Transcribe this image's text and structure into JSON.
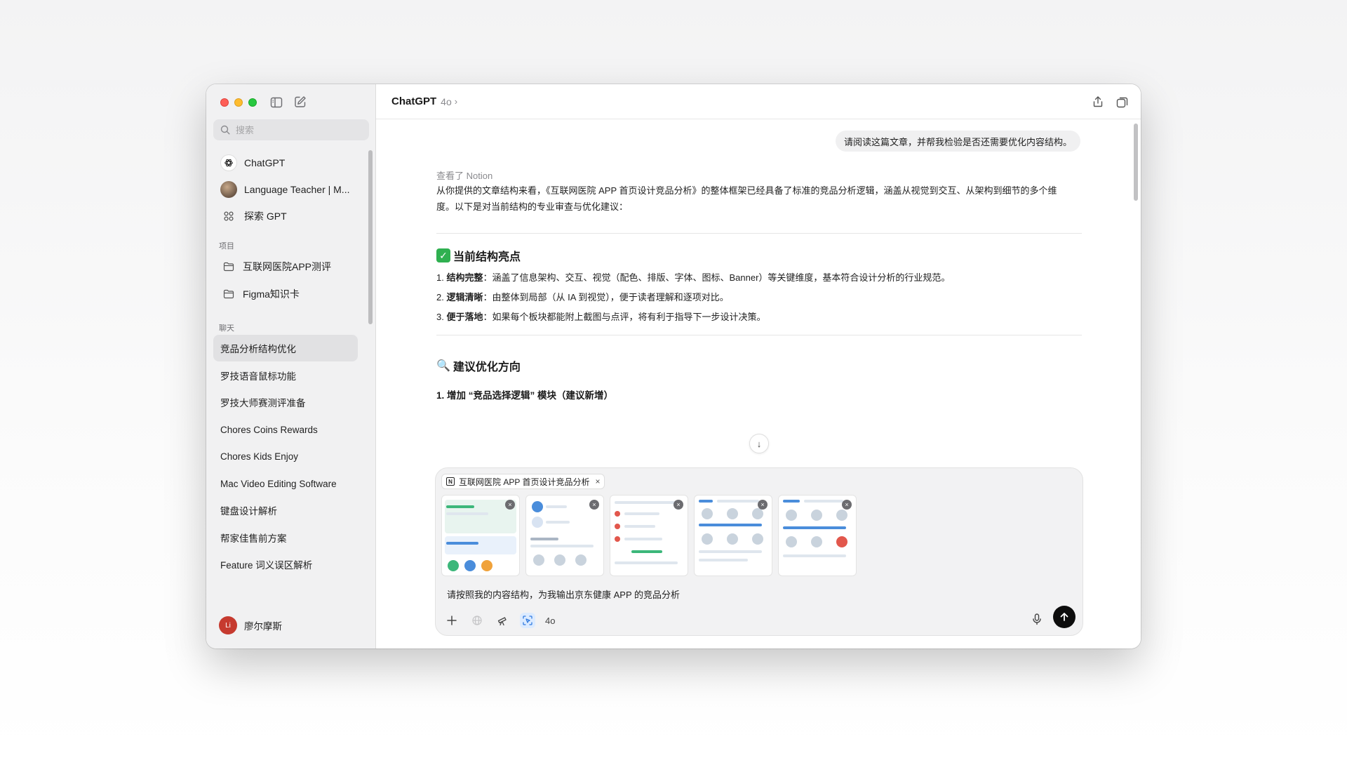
{
  "sidebar": {
    "search_placeholder": "搜索",
    "gpts": [
      {
        "label": "ChatGPT",
        "icon": "openai-logo-icon"
      },
      {
        "label": "Language Teacher | M...",
        "icon": "gpt-avatar-icon"
      },
      {
        "label": "探索 GPT",
        "icon": "grid-icon"
      }
    ],
    "projects_label": "项目",
    "projects": [
      {
        "label": "互联网医院APP测评",
        "icon": "folder-icon"
      },
      {
        "label": "Figma知识卡",
        "icon": "folder-icon"
      }
    ],
    "chats_label": "聊天",
    "chats": [
      {
        "label": "竞品分析结构优化",
        "active": true
      },
      {
        "label": "罗技语音鼠标功能"
      },
      {
        "label": "罗技大师赛测评准备"
      },
      {
        "label": "Chores Coins Rewards"
      },
      {
        "label": "Chores Kids Enjoy"
      },
      {
        "label": "Mac Video Editing Software"
      },
      {
        "label": "键盘设计解析"
      },
      {
        "label": "帮家佳售前方案"
      },
      {
        "label": "Feature 词义误区解析"
      }
    ],
    "user": {
      "initials": "Li",
      "name": "廖尔摩斯"
    }
  },
  "header": {
    "title": "ChatGPT",
    "model": "4o",
    "chevron": "›"
  },
  "conversation": {
    "user_message": "请阅读这篇文章，并帮我检验是否还需要优化内容结构。",
    "viewed_source": "查看了 Notion",
    "intro_line1": "从你提供的文章结构来看，《互联网医院 APP 首页设计竞品分析》的整体框架已经具备了标准的竞品分析逻辑，涵盖从视觉到交互、从架构到细节的多个维",
    "intro_line2": "度。以下是对当前结构的专业审查与优化建议：",
    "section1_title": "当前结构亮点",
    "section1_emoji": "✓",
    "highlights": [
      {
        "num": "1.",
        "bold": "结构完整",
        "text": "：涵盖了信息架构、交互、视觉（配色、排版、字体、图标、Banner）等关键维度，基本符合设计分析的行业规范。"
      },
      {
        "num": "2.",
        "bold": "逻辑清晰",
        "text": "：由整体到局部（从 IA 到视觉），便于读者理解和逐项对比。"
      },
      {
        "num": "3.",
        "bold": "便于落地",
        "text": "：如果每个板块都能附上截图与点评，将有利于指导下一步设计决策。"
      }
    ],
    "section2_title": "建议优化方向",
    "section2_emoji": "🔍",
    "sub1": "1. 增加 “竞品选择逻辑” 模块（建议新增）",
    "scroll_down": "↓"
  },
  "composer": {
    "attachment_label": "互联网医院 APP 首页设计竞品分析",
    "attachment_close": "×",
    "thumbnails": [
      {
        "name": "screenshot-1"
      },
      {
        "name": "screenshot-2"
      },
      {
        "name": "screenshot-3"
      },
      {
        "name": "screenshot-4"
      },
      {
        "name": "screenshot-5"
      }
    ],
    "input_text": "请按照我的内容结构，为我输出京东健康 APP 的竞品分析",
    "model_label": "4o"
  }
}
